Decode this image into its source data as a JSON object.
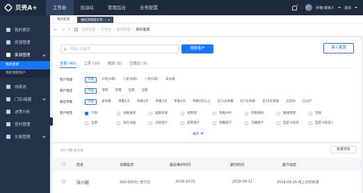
{
  "app": {
    "logo": "贝壳A+",
    "top_nav": [
      "工作台",
      "加油站",
      "管理后台",
      "业务配置"
    ],
    "user_name": "乔楠-链家人",
    "logout": "退出"
  },
  "sidebar": {
    "items": [
      {
        "label": "我的首页",
        "icon": "home-icon"
      },
      {
        "label": "房源管理",
        "icon": "house-icon"
      },
      {
        "label": "客源管理",
        "icon": "user-icon",
        "open": true
      },
      {
        "label": "线索池",
        "icon": "target-icon"
      },
      {
        "label": "门店/商圈",
        "icon": "store-icon"
      },
      {
        "label": "决策分析",
        "icon": "chart-icon"
      },
      {
        "label": "签约管理",
        "icon": "contract-icon"
      },
      {
        "label": "交易管理",
        "icon": "deal-icon"
      }
    ],
    "sub_items": [
      {
        "label": "我的客源",
        "active": true
      },
      {
        "label": "我的潜客客户",
        "active": false
      }
    ]
  },
  "tabs": [
    {
      "label": "我的客源",
      "dark": false
    },
    {
      "label": "维权流程提示单…",
      "dark": true
    }
  ],
  "breadcrumb": {
    "items": [
      "当前位置",
      "工作台",
      "客源管理",
      "我的客源"
    ]
  },
  "search": {
    "placeholder": "请输入关键词",
    "button": "搜索客户",
    "import_button": "录入客源"
  },
  "category_tabs": [
    {
      "label": "全部 (40)",
      "active": true
    },
    {
      "label": "二手 (20)",
      "active": false
    },
    {
      "label": "租赁 (5)",
      "active": false
    },
    {
      "label": "已成交 (5)",
      "active": false
    }
  ],
  "filters": [
    {
      "label": "客户等级",
      "options": [
        "不限",
        "三星(A级)",
        "二星(B级)",
        "一星(C级)",
        "未分级"
      ],
      "active": 0
    },
    {
      "label": "客户需求",
      "options": [
        "不限",
        "求购",
        "求租",
        "出租",
        "出售"
      ],
      "active": 0
    },
    {
      "label": "最近带看",
      "options": [
        "不限",
        "未带看",
        "带看1次",
        "带看2次",
        "带看3次",
        "带看4次",
        "带看5次以上",
        "近三天带看",
        "近7天带看",
        "近15天带看",
        "已签约",
        "已过户"
      ],
      "active": 0
    }
  ],
  "tags": {
    "label": "客户标签",
    "row1": [
      {
        "label": "不限",
        "on": true
      },
      {
        "label": "待跟进客",
        "on": false
      },
      {
        "label": "诚意买家",
        "on": false
      },
      {
        "label": "潜客库",
        "on": false
      },
      {
        "label": "带看APP",
        "on": false
      },
      {
        "label": "带看预约",
        "on": false
      },
      {
        "label": "跟进客客",
        "on": false
      },
      {
        "label": "贷款",
        "on": false
      }
    ],
    "row2": [
      {
        "label": "全部",
        "on": false
      },
      {
        "label": "短信询盘",
        "on": false
      },
      {
        "label": "活跃客户",
        "on": false
      },
      {
        "label": "成熟客户",
        "on": false
      },
      {
        "label": "预警客户",
        "on": false
      },
      {
        "label": "沉睡客户",
        "on": false
      },
      {
        "label": "自定义标签",
        "on": false
      },
      {
        "label": "自定义标签2",
        "on": false
      }
    ],
    "expand": "展开"
  },
  "list": {
    "total_prefix": "共计",
    "total": "50",
    "total_suffix": "条记录",
    "batch_button": "批量无效",
    "columns": [
      "姓名",
      "详细需求",
      "最近维护时间",
      "委托时间",
      "客户动态"
    ],
    "rows": [
      {
        "name": "张小姐",
        "need": "500-600万; 安宁庄",
        "maintain": "2018-10-01",
        "entrust": "2018-09-11",
        "dynamic": "2018-09-25 线上浏览房源"
      }
    ]
  }
}
